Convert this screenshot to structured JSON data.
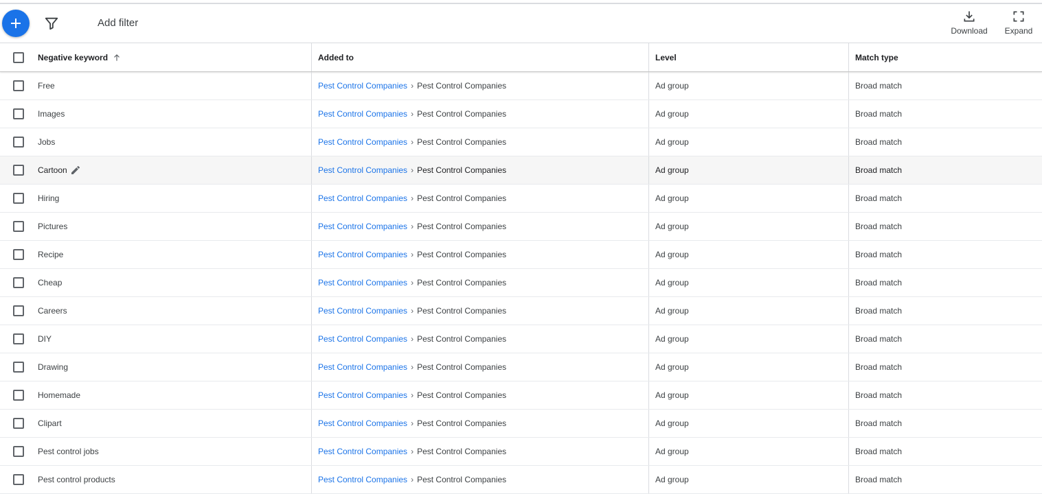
{
  "toolbar": {
    "add_filter_label": "Add filter",
    "download_label": "Download",
    "expand_label": "Expand",
    "icons": {
      "fab": "plus-icon",
      "filter": "filter-icon",
      "download": "download-icon",
      "expand": "fullscreen-icon"
    },
    "accent_color": "#1a73e8"
  },
  "table": {
    "columns": [
      "Negative keyword",
      "Added to",
      "Level",
      "Match type"
    ],
    "sorted_column": "Negative keyword",
    "sort_direction": "ascending",
    "rows": [
      {
        "keyword": "Free",
        "campaign": "Pest Control Companies",
        "ad_group": "Pest Control Companies",
        "level": "Ad group",
        "match_type": "Broad match"
      },
      {
        "keyword": "Images",
        "campaign": "Pest Control Companies",
        "ad_group": "Pest Control Companies",
        "level": "Ad group",
        "match_type": "Broad match"
      },
      {
        "keyword": "Jobs",
        "campaign": "Pest Control Companies",
        "ad_group": "Pest Control Companies",
        "level": "Ad group",
        "match_type": "Broad match"
      },
      {
        "keyword": "Cartoon",
        "campaign": "Pest Control Companies",
        "ad_group": "Pest Control Companies",
        "level": "Ad group",
        "match_type": "Broad match"
      },
      {
        "keyword": "Hiring",
        "campaign": "Pest Control Companies",
        "ad_group": "Pest Control Companies",
        "level": "Ad group",
        "match_type": "Broad match"
      },
      {
        "keyword": "Pictures",
        "campaign": "Pest Control Companies",
        "ad_group": "Pest Control Companies",
        "level": "Ad group",
        "match_type": "Broad match"
      },
      {
        "keyword": "Recipe",
        "campaign": "Pest Control Companies",
        "ad_group": "Pest Control Companies",
        "level": "Ad group",
        "match_type": "Broad match"
      },
      {
        "keyword": "Cheap",
        "campaign": "Pest Control Companies",
        "ad_group": "Pest Control Companies",
        "level": "Ad group",
        "match_type": "Broad match"
      },
      {
        "keyword": "Careers",
        "campaign": "Pest Control Companies",
        "ad_group": "Pest Control Companies",
        "level": "Ad group",
        "match_type": "Broad match"
      },
      {
        "keyword": "DIY",
        "campaign": "Pest Control Companies",
        "ad_group": "Pest Control Companies",
        "level": "Ad group",
        "match_type": "Broad match"
      },
      {
        "keyword": "Drawing",
        "campaign": "Pest Control Companies",
        "ad_group": "Pest Control Companies",
        "level": "Ad group",
        "match_type": "Broad match"
      },
      {
        "keyword": "Homemade",
        "campaign": "Pest Control Companies",
        "ad_group": "Pest Control Companies",
        "level": "Ad group",
        "match_type": "Broad match"
      },
      {
        "keyword": "Clipart",
        "campaign": "Pest Control Companies",
        "ad_group": "Pest Control Companies",
        "level": "Ad group",
        "match_type": "Broad match"
      },
      {
        "keyword": "Pest control jobs",
        "campaign": "Pest Control Companies",
        "ad_group": "Pest Control Companies",
        "level": "Ad group",
        "match_type": "Broad match"
      },
      {
        "keyword": "Pest control products",
        "campaign": "Pest Control Companies",
        "ad_group": "Pest Control Companies",
        "level": "Ad group",
        "match_type": "Broad match"
      }
    ],
    "hovered_row_index": 3
  }
}
